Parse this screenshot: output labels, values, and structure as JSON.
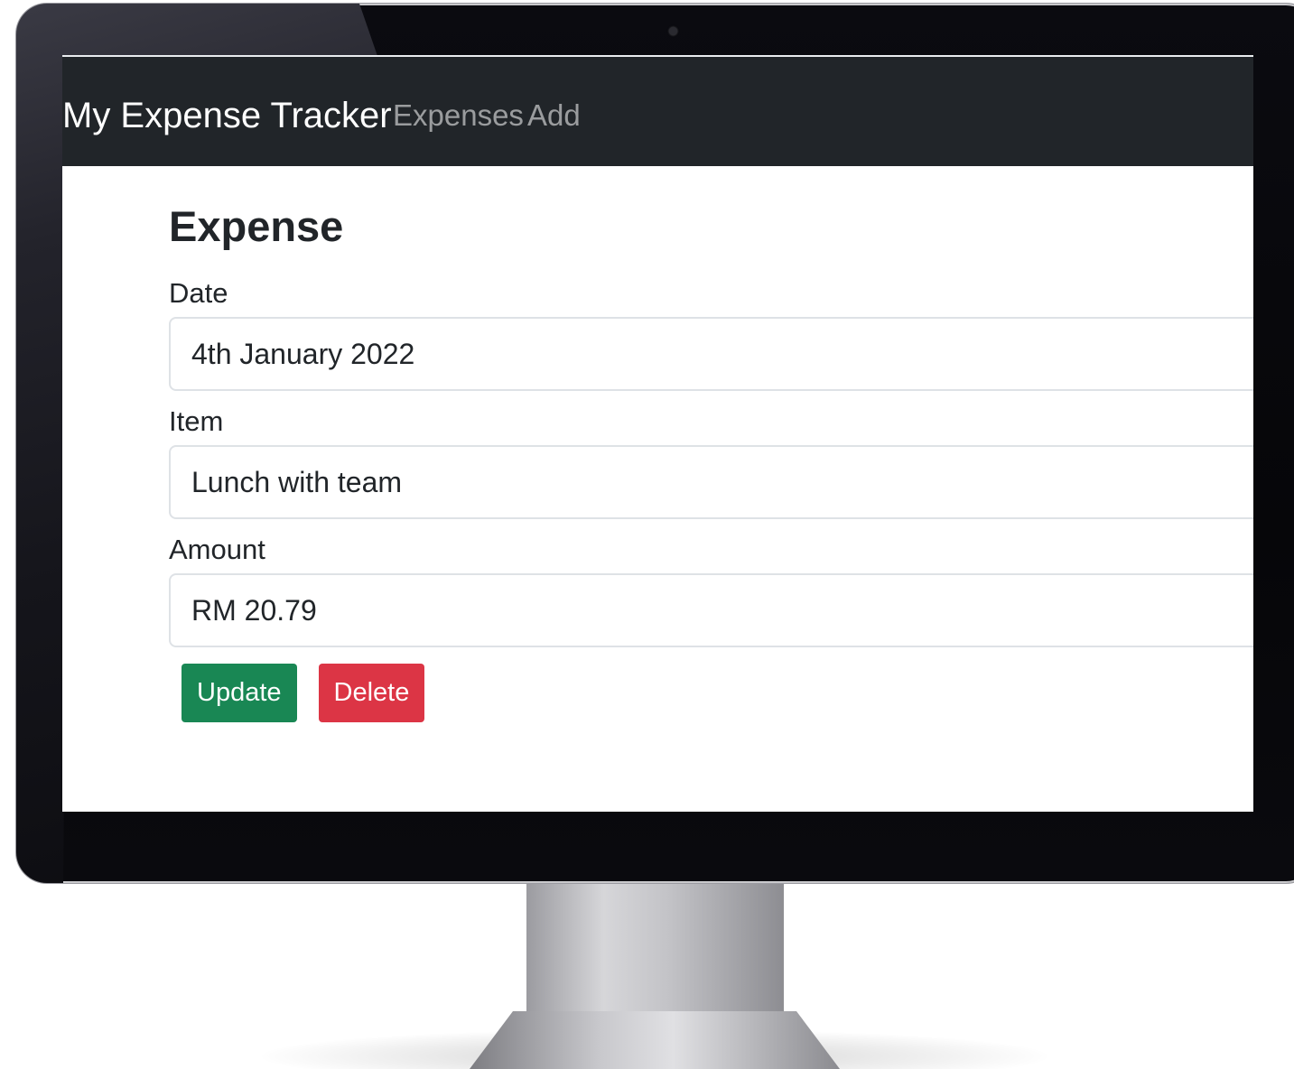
{
  "navbar": {
    "brand": "My Expense Tracker",
    "links": {
      "expenses": "Expenses",
      "add": "Add"
    }
  },
  "form": {
    "title": "Expense",
    "date": {
      "label": "Date",
      "value": "4th January 2022"
    },
    "item": {
      "label": "Item",
      "value": "Lunch with team"
    },
    "amount": {
      "label": "Amount",
      "value": "RM 20.79"
    },
    "buttons": {
      "update": "Update",
      "delete": "Delete"
    }
  },
  "colors": {
    "navbar_bg": "#212529",
    "update_button": "#198754",
    "delete_button": "#dc3545"
  }
}
